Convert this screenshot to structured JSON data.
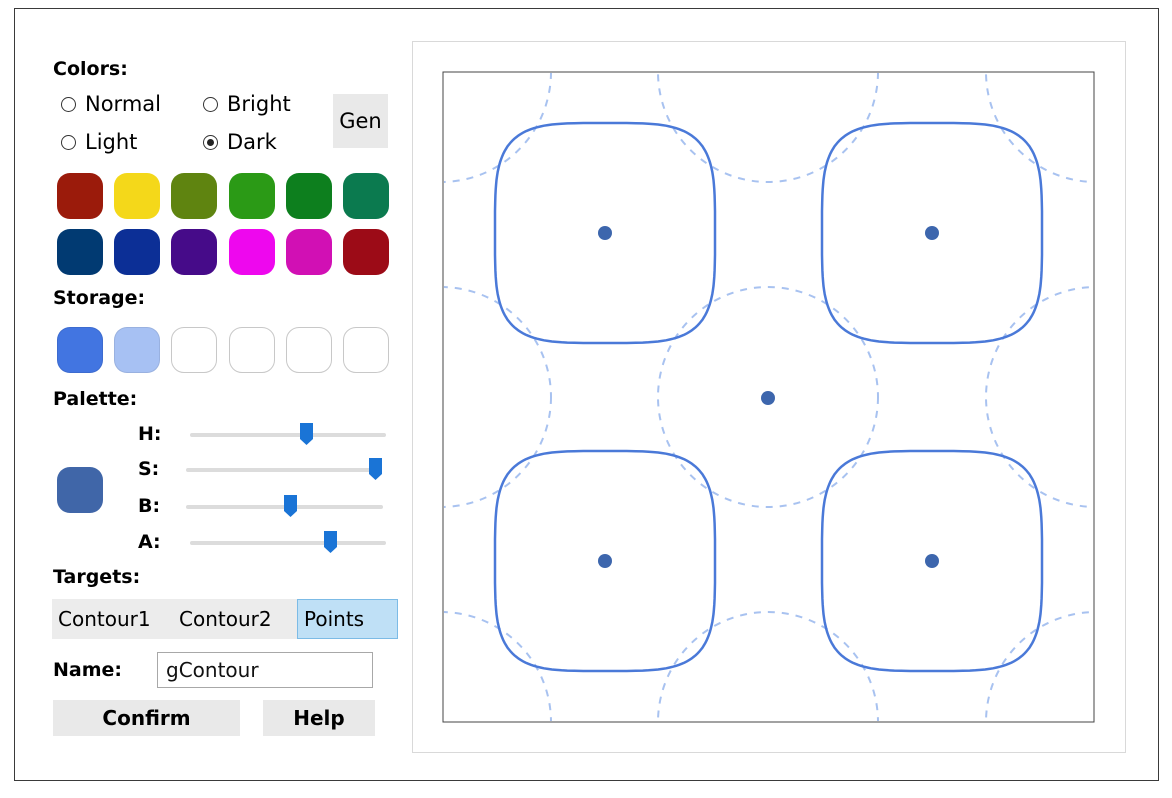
{
  "colors": {
    "label": "Colors:",
    "modes": [
      {
        "label": "Normal",
        "checked": false
      },
      {
        "label": "Bright",
        "checked": false
      },
      {
        "label": "Light",
        "checked": false
      },
      {
        "label": "Dark",
        "checked": true
      }
    ],
    "gen_label": "Gen",
    "swatches": [
      "#9b1b0b",
      "#f4d81a",
      "#5f8410",
      "#2b9a16",
      "#0d7f1e",
      "#0b7a4f",
      "#013a72",
      "#0c2f96",
      "#460b89",
      "#ee07ee",
      "#d110b4",
      "#9c0b17"
    ]
  },
  "storage": {
    "label": "Storage:",
    "swatches": [
      "#4275e1",
      "#a7c1f3",
      "",
      "",
      "",
      ""
    ]
  },
  "palette": {
    "label": "Palette:",
    "preview_color": "#4066a8",
    "sliders": [
      {
        "label": "H:",
        "value": 0.6
      },
      {
        "label": "S:",
        "value": 1.0
      },
      {
        "label": "B:",
        "value": 0.53
      },
      {
        "label": "A:",
        "value": 0.73
      }
    ]
  },
  "targets": {
    "label": "Targets:",
    "tabs": [
      {
        "label": "Contour1",
        "active": false
      },
      {
        "label": "Contour2",
        "active": false
      },
      {
        "label": "Points",
        "active": true
      }
    ]
  },
  "name": {
    "label": "Name:",
    "value": "gContour"
  },
  "buttons": {
    "confirm": "Confirm",
    "help": "Help"
  },
  "plot": {
    "contour_color": "#4a79d8",
    "dashed_color": "#a8c2f0",
    "point_color": "#3d66ad"
  }
}
